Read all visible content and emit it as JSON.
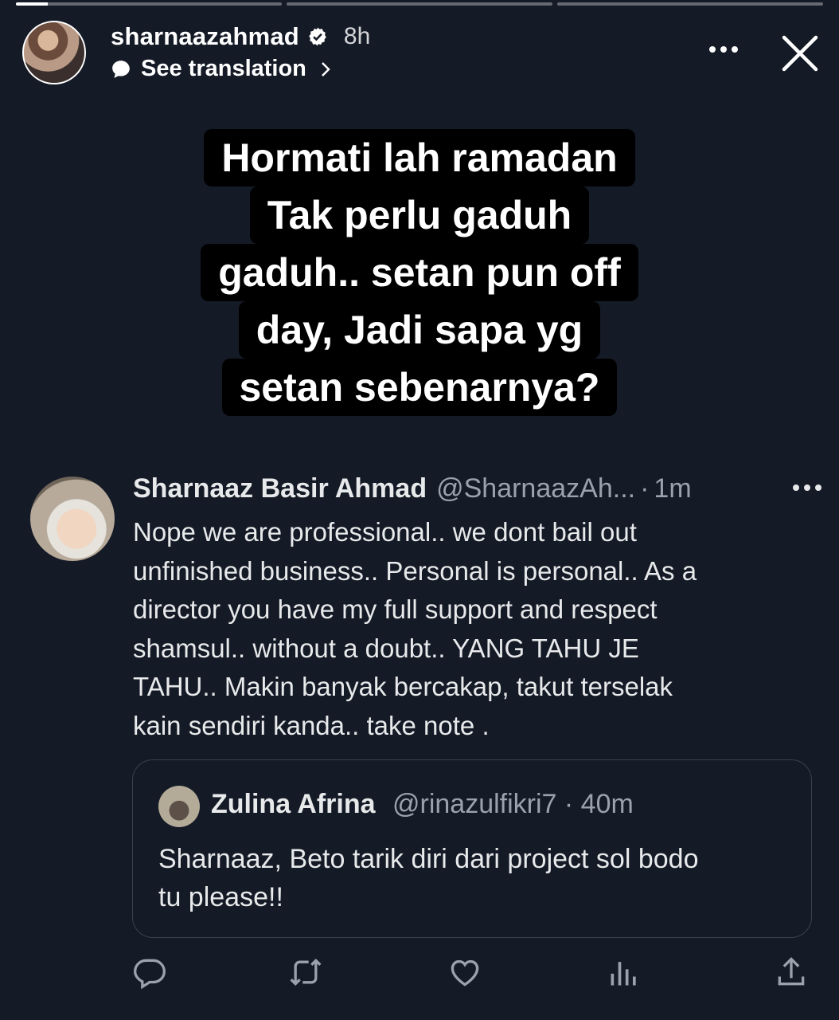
{
  "story": {
    "progress": [
      1,
      0,
      0
    ],
    "username": "sharnaazahmad",
    "time": "8h",
    "translate_label": "See translation",
    "sticker_lines": [
      "Hormati lah ramadan",
      "Tak perlu gaduh",
      "gaduh.. setan pun off",
      "day, Jadi sapa yg",
      "setan sebenarnya?"
    ]
  },
  "tweet": {
    "name": "Sharnaaz Basir Ahmad",
    "handle": "@SharnaazAh...",
    "time": "1m",
    "text_lines": [
      "Nope we are professional.. we dont bail out",
      "unfinished business.. Personal is personal.. As a",
      "director you have my full support and respect",
      "shamsul.. without a doubt.. YANG TAHU JE",
      "TAHU.. Makin banyak bercakap, takut terselak",
      "kain sendiri kanda.. take note ."
    ],
    "quote": {
      "name": "Zulina Afrina",
      "handle": "@rinazulfikri7 · 40m",
      "text_lines": [
        "Sharnaaz, Beto tarik diri dari project sol bodo",
        "tu please!!"
      ]
    },
    "actions": [
      "reply-icon",
      "retweet-icon",
      "like-icon",
      "views-icon",
      "share-icon"
    ]
  }
}
